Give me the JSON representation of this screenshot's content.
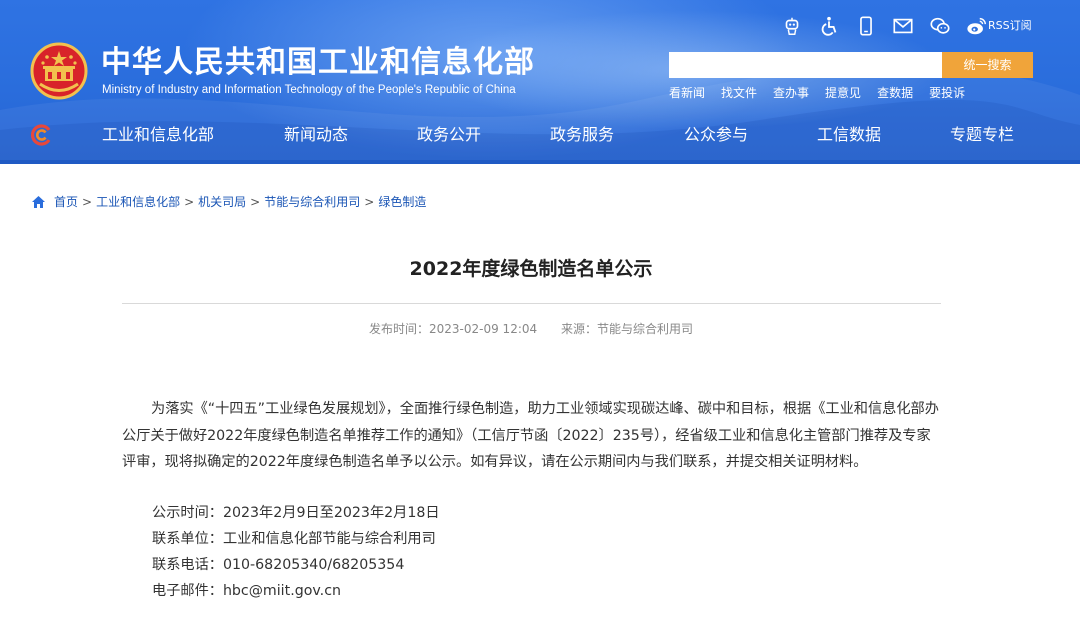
{
  "header": {
    "title": "中华人民共和国工业和信息化部",
    "subtitle": "Ministry of Industry and Information Technology of the People's Republic of China",
    "top_icons": [
      "robot-icon",
      "accessibility-icon",
      "mobile-icon",
      "mail-icon",
      "wechat-icon",
      "weibo-icon"
    ],
    "rss_label": "RSS订阅",
    "search": {
      "placeholder": "",
      "button_label": "统一搜索"
    },
    "quick_links": [
      "看新闻",
      "找文件",
      "查办事",
      "提意见",
      "查数据",
      "要投诉"
    ],
    "nav": [
      "工业和信息化部",
      "新闻动态",
      "政务公开",
      "政务服务",
      "公众参与",
      "工信数据",
      "专题专栏"
    ]
  },
  "breadcrumb": [
    "首页",
    "工业和信息化部",
    "机关司局",
    "节能与综合利用司",
    "绿色制造"
  ],
  "article": {
    "title": "2022年度绿色制造名单公示",
    "publish_time": "发布时间：2023-02-09 12:04",
    "source": "来源：节能与综合利用司",
    "paragraph": "为落实《“十四五”工业绿色发展规划》，全面推行绿色制造，助力工业领域实现碳达峰、碳中和目标，根据《工业和信息化部办公厅关于做好2022年度绿色制造名单推荐工作的通知》（工信厅节函〔2022〕235号），经省级工业和信息化主管部门推荐及专家评审，现将拟确定的2022年度绿色制造名单予以公示。如有异议，请在公示期间内与我们联系，并提交相关证明材料。",
    "period": "公示时间：2023年2月9日至2023年2月18日",
    "unit": "联系单位：工业和信息化部节能与综合利用司",
    "phone": "联系电话：010-68205340/68205354",
    "email": "电子邮件：hbc@miit.gov.cn"
  },
  "colors": {
    "header_blue": "#2a6ddc",
    "search_orange": "#f0a43a",
    "link_blue": "#1a55b5"
  }
}
